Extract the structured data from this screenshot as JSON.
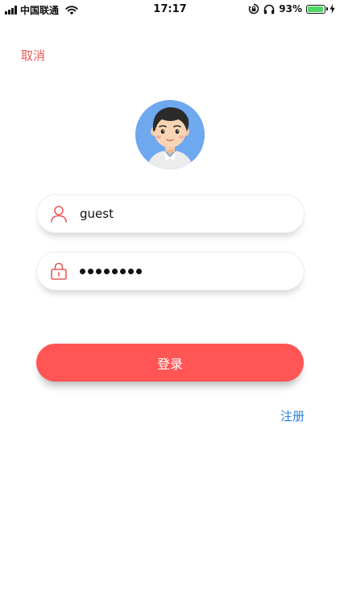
{
  "status_bar": {
    "carrier": "中国联通",
    "time": "17:17",
    "battery": "93%",
    "battery_level": 0.93,
    "icons": [
      "signal-icon",
      "wifi-icon",
      "rotation-lock-icon",
      "headphones-icon",
      "battery-icon",
      "charging-icon"
    ]
  },
  "header": {
    "cancel_label": "取消"
  },
  "avatar": {
    "icon": "user-avatar",
    "background_color": "#6ea8ef"
  },
  "form": {
    "username": {
      "icon": "user-icon",
      "value": "guest"
    },
    "password": {
      "icon": "lock-icon",
      "masked_length": 8
    }
  },
  "login_button": {
    "label": "登录",
    "color": "#ff5555"
  },
  "register_link": {
    "label": "注册",
    "color": "#2d7fd6"
  },
  "colors": {
    "accent": "#ff5555",
    "cancel": "#e95b5b",
    "link": "#2d7fd6"
  }
}
